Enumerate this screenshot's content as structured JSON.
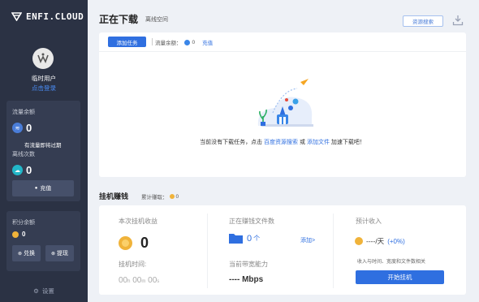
{
  "sidebar": {
    "brand": "ENFI.CLOUD",
    "user_name": "临时用户",
    "login_link": "点击登录",
    "traffic_label": "流量余额",
    "traffic_value": "0",
    "expire_note": "有流量即将过期",
    "offline_label": "离线次数",
    "offline_value": "0",
    "recharge_label": "充值",
    "points_label": "积分余额",
    "points_value": "0",
    "exchange_label": "兑换",
    "withdraw_label": "提现",
    "settings_label": "设置"
  },
  "header": {
    "title": "正在下载",
    "subtitle": "离线空间",
    "resource_button": "资源搜索"
  },
  "downloads": {
    "add_task": "添加任务",
    "traffic_label": "流量余额：",
    "traffic_value": "0",
    "charge_link": "充值",
    "empty_prefix": "当前没有下载任务，点击",
    "empty_link1": "百度资源搜索",
    "empty_or": "或",
    "empty_link2": "添加文件",
    "empty_suffix": "加速下载吧！"
  },
  "earn": {
    "title": "挂机赚钱",
    "total_label": "累计赚取：",
    "total_value": "0",
    "session_label": "本次挂机收益",
    "session_value": "0",
    "time_label": "挂机时间:",
    "time_h": "00",
    "time_h_unit": "h",
    "time_m": "00",
    "time_m_unit": "m",
    "time_s": "00",
    "time_s_unit": "s",
    "files_label": "正在赚钱文件数",
    "files_value": "0",
    "files_unit": "个",
    "add_link": "添加>",
    "bandwidth_label": "当前带宽能力",
    "bandwidth_value": "---- Mbps",
    "estimate_label": "预计收入",
    "estimate_value": "----/天",
    "estimate_pct": "(+0%)",
    "estimate_note": "收入与时间、宽度和文件数相关",
    "start_button": "开始挂机"
  },
  "colors": {
    "sidebar_bg": "#2b3244",
    "accent": "#2f6fe0",
    "gold": "#f0b33a"
  }
}
